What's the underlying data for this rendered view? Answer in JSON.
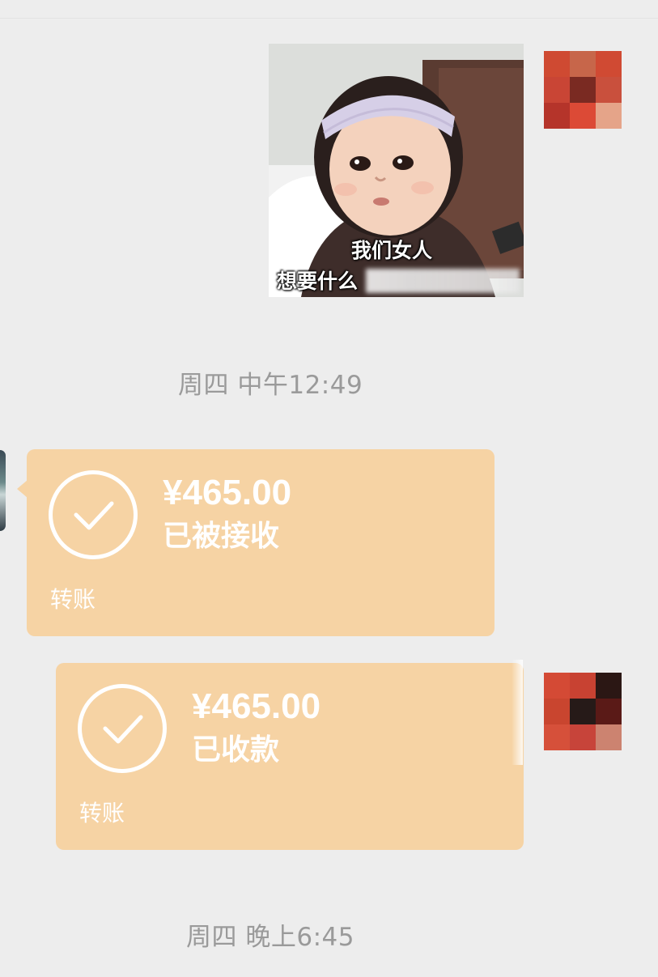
{
  "sticker": {
    "caption_line1": "我们女人",
    "caption_line2": "想要什么"
  },
  "timestamps": {
    "first": "周四 中午12:49",
    "second": "周四 晚上6:45"
  },
  "transfers": [
    {
      "amount": "¥465.00",
      "status": "已被接收",
      "label": "转账",
      "direction": "incoming"
    },
    {
      "amount": "¥465.00",
      "status": "已收款",
      "label": "转账",
      "direction": "outgoing"
    }
  ],
  "colors": {
    "background": "#ededed",
    "transfer_card": "#f6d3a4",
    "timestamp_text": "#9a9a9a"
  },
  "avatars": {
    "me_1_mosaic": [
      "#cf4a32",
      "#c7664a",
      "#d04a33",
      "#c94535",
      "#7a2a22",
      "#c9503d",
      "#b5342a",
      "#dc4a36",
      "#e5a489"
    ],
    "me_2_mosaic": [
      "#d44a35",
      "#c84232",
      "#2b1714",
      "#c9452f",
      "#261a18",
      "#5a1a17",
      "#d6503a",
      "#c7443a",
      "#cc8370"
    ]
  }
}
